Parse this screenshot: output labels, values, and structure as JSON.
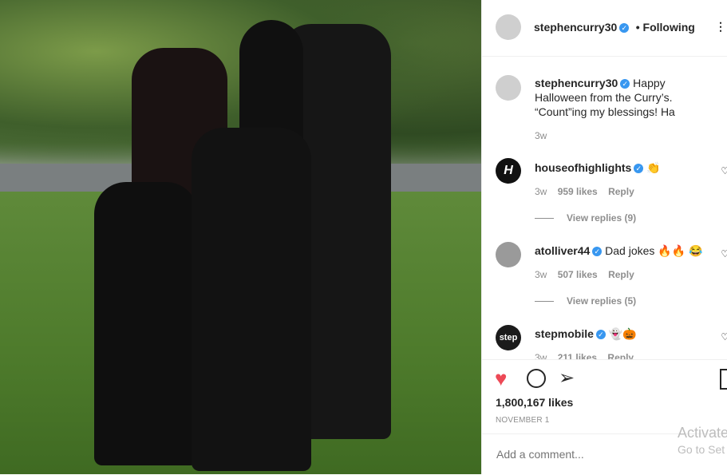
{
  "post": {
    "username": "stephencurry30",
    "follow_status": "• Following",
    "caption": "Happy Halloween from the Curry’s. “Count”ing my blessings! Ha",
    "time_ago": "3w",
    "likes": "1,800,167 likes",
    "date": "NOVEMBER 1",
    "comment_placeholder": "Add a comment..."
  },
  "comments": [
    {
      "username": "houseofhighlights",
      "text": "👏",
      "time": "3w",
      "likes": "959 likes",
      "reply": "Reply",
      "view_replies": "View replies (9)"
    },
    {
      "username": "atolliver44",
      "text": "Dad jokes 🔥🔥 😂",
      "time": "3w",
      "likes": "507 likes",
      "reply": "Reply",
      "view_replies": "View replies (5)"
    },
    {
      "username": "stepmobile",
      "text": "👻🎃",
      "time": "3w",
      "likes": "211 likes",
      "reply": "Reply"
    }
  ],
  "icons": {
    "verified": "verified-badge-icon",
    "more": "more-options-icon",
    "like": "heart-filled-icon",
    "comment": "comment-bubble-icon",
    "share": "paper-plane-icon",
    "save": "bookmark-icon"
  },
  "colors": {
    "like_red": "#ed4956",
    "verified_blue": "#3897f0",
    "text": "#262626",
    "muted": "#8e8e8e"
  },
  "system": {
    "watermark_line1": "Activate",
    "watermark_line2": "Go to Set"
  }
}
